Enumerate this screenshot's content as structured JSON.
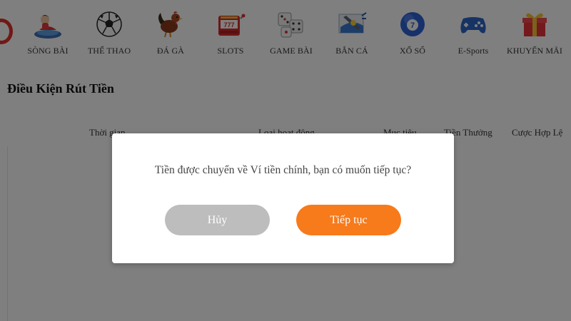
{
  "nav": {
    "items": [
      {
        "label": "SÒNG BÀI",
        "icon": "casino-girl-icon"
      },
      {
        "label": "THỂ THAO",
        "icon": "soccer-ball-icon"
      },
      {
        "label": "ĐÁ GÀ",
        "icon": "rooster-icon"
      },
      {
        "label": "SLOTS",
        "icon": "slot-machine-icon"
      },
      {
        "label": "GAME BÀI",
        "icon": "dice-icon"
      },
      {
        "label": "BẮN CÁ",
        "icon": "fish-shooting-icon"
      },
      {
        "label": "XỔ SỐ",
        "icon": "lottery-ball-icon"
      },
      {
        "label": "E-Sports",
        "icon": "gamepad-icon"
      },
      {
        "label": "KHUYẾN MÃI",
        "icon": "gift-box-icon"
      }
    ],
    "slots_icon_text": "777",
    "lottery_ball_number": "7"
  },
  "page": {
    "title": "Điều Kiện Rút Tiền",
    "columns": [
      "Thời gian",
      "Loại hoạt động",
      "Mục tiêu",
      "Tiền Thưởng",
      "Cược Hợp Lệ"
    ]
  },
  "dialog": {
    "message": "Tiền được chuyển về Ví tiền chính, bạn có muốn tiếp tục?",
    "cancel_label": "Hủy",
    "confirm_label": "Tiếp tục"
  },
  "colors": {
    "accent": "#f77a1b",
    "cancel": "#bdbdbd",
    "overlay": "rgba(0,0,0,0.5)",
    "brand_red": "#e0322b"
  }
}
